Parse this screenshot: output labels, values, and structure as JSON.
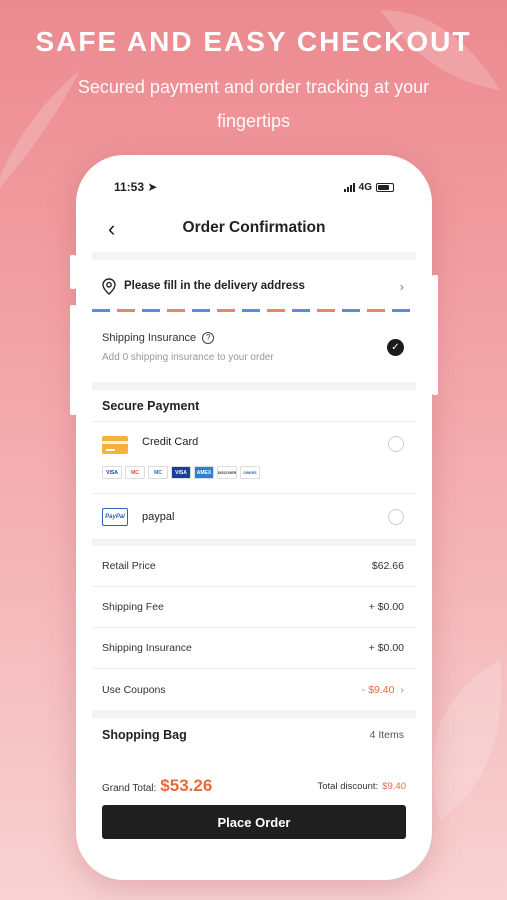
{
  "banner": {
    "headline": "SAFE AND EASY CHECKOUT",
    "subline": "Secured payment and order tracking at your fingertips"
  },
  "status_bar": {
    "time": "11:53",
    "network": "4G"
  },
  "nav": {
    "title": "Order Confirmation"
  },
  "address": {
    "prompt": "Please fill in the delivery address"
  },
  "insurance": {
    "title": "Shipping Insurance",
    "subtitle": "Add 0 shipping insurance to your order",
    "checked": true
  },
  "payment": {
    "title": "Secure Payment",
    "methods": [
      {
        "name": "Credit Card",
        "logos": [
          "VISA",
          "MC",
          "MC",
          "VISA",
          "AMEX",
          "DISCOVER",
          "DINERS"
        ]
      },
      {
        "name": "paypal",
        "logo": "PayPal"
      }
    ]
  },
  "summary": {
    "rows": [
      {
        "label": "Retail Price",
        "value": "$62.66"
      },
      {
        "label": "Shipping Fee",
        "value": "+ $0.00"
      },
      {
        "label": "Shipping Insurance",
        "value": "+ $0.00"
      },
      {
        "label": "Use Coupons",
        "value": "- $9.40"
      }
    ]
  },
  "bag": {
    "title": "Shopping Bag",
    "count": "4 Items"
  },
  "checkout": {
    "grand_label": "Grand Total:",
    "grand_value": "$53.26",
    "discount_label": "Total discount:",
    "discount_value": "$9.40",
    "button": "Place Order"
  },
  "colors": {
    "accent": "#e86a3a",
    "button": "#1f1f1f",
    "background": "#ec8a8f"
  }
}
